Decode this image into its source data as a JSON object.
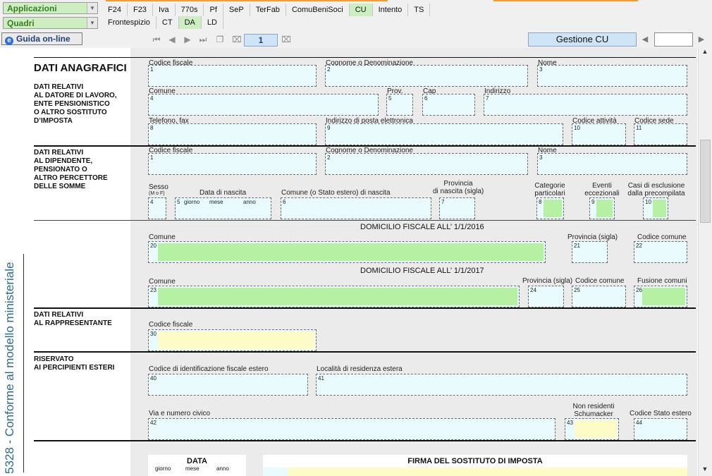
{
  "toolbar": {
    "applicazioni_label": "Applicazioni",
    "quadri_label": "Quadri",
    "main_tabs": [
      "F24",
      "F23",
      "Iva",
      "770s",
      "Pf",
      "SeP",
      "TerFab",
      "ComuBeniSoci",
      "CU",
      "Intento",
      "TS"
    ],
    "active_main_tab": "CU",
    "sub_tabs": [
      "Frontespizio",
      "CT",
      "DA",
      "LD"
    ],
    "active_sub_tab": "DA",
    "guida_label": "Guida on-line",
    "page_number": "1",
    "gestione_label": "Gestione CU",
    "accent_green": "#cdeec0"
  },
  "side": {
    "text": "5328 - Conforme al modello ministeriale"
  },
  "sections": {
    "main_title": "DATI ANAGRAFICI",
    "datore_desc": [
      "DATI RELATIVI",
      "AL DATORE DI LAVORO,",
      "ENTE PENSIONISTICO",
      "O ALTRO SOSTITUTO",
      "D’IMPOSTA"
    ],
    "dipendente_desc": [
      "DATI RELATIVI",
      "AL DIPENDENTE,",
      "PENSIONATO O",
      "ALTRO PERCETTORE",
      "DELLE SOMME"
    ],
    "rappresentante_desc": [
      "DATI RELATIVI",
      "AL RAPPRESENTANTE"
    ],
    "esteri_desc": [
      "RISERVATO",
      "AI PERCIPIENTI ESTERI"
    ]
  },
  "datore": {
    "codice_fiscale": "Codice fiscale",
    "cognome": "Cognome o Denominazione",
    "nome": "Nome",
    "comune": "Comune",
    "prov": "Prov.",
    "cap": "Cap",
    "indirizzo": "Indirizzo",
    "telefono": "Telefono, fax",
    "email": "Indirizzo di posta elettronica",
    "codice_attivita": "Codice attività",
    "codice_sede": "Codice sede"
  },
  "dipendente": {
    "codice_fiscale": "Codice fiscale",
    "cognome": "Cognome o Denominazione",
    "nome": "Nome",
    "sesso": "Sesso",
    "sesso_hint": "(M o F)",
    "data_nascita": "Data di nascita",
    "giorno": "giorno",
    "mese": "mese",
    "anno": "anno",
    "comune_nascita": "Comune (o Stato estero) di nascita",
    "provincia_nascita_1": "Provincia",
    "provincia_nascita_2": "di nascita (sigla)",
    "categorie_1": "Categorie",
    "categorie_2": "particolari",
    "eventi_1": "Eventi",
    "eventi_2": "eccezionali",
    "casi_1": "Casi di esclusione",
    "casi_2": "dalla precompilata"
  },
  "domicilio_2016": {
    "title": "DOMICILIO FISCALE ALL’ 1/1/2016",
    "comune": "Comune",
    "provincia": "Provincia (sigla)",
    "codice_comune": "Codice comune"
  },
  "domicilio_2017": {
    "title": "DOMICILIO FISCALE ALL’ 1/1/2017",
    "comune": "Comune",
    "provincia": "Provincia (sigla)",
    "codice_comune": "Codice comune",
    "fusione": "Fusione comuni"
  },
  "rappresentante": {
    "codice_fiscale": "Codice fiscale"
  },
  "esteri": {
    "codice_identificazione": "Codice di identificazione fiscale estero",
    "localita": "Località di residenza estera",
    "via": "Via e numero civico",
    "non_residenti_1": "Non residenti",
    "non_residenti_2": "Schumacker",
    "codice_stato": "Codice Stato estero"
  },
  "bottom": {
    "data_title": "DATA",
    "giorno": "giorno",
    "mese": "mese",
    "anno": "anno",
    "firma_title": "FIRMA DEL SOSTITUTO DI IMPOSTA"
  },
  "field_numbers": {
    "n1": "1",
    "n2": "2",
    "n3": "3",
    "n4": "4",
    "n5": "5",
    "n6": "6",
    "n7": "7",
    "n8": "8",
    "n9": "9",
    "n10": "10",
    "n11": "11",
    "n20": "20",
    "n21": "21",
    "n22": "22",
    "n23": "23",
    "n24": "24",
    "n25": "25",
    "n26": "26",
    "n30": "30",
    "n40": "40",
    "n41": "41",
    "n42": "42",
    "n43": "43",
    "n44": "44"
  }
}
